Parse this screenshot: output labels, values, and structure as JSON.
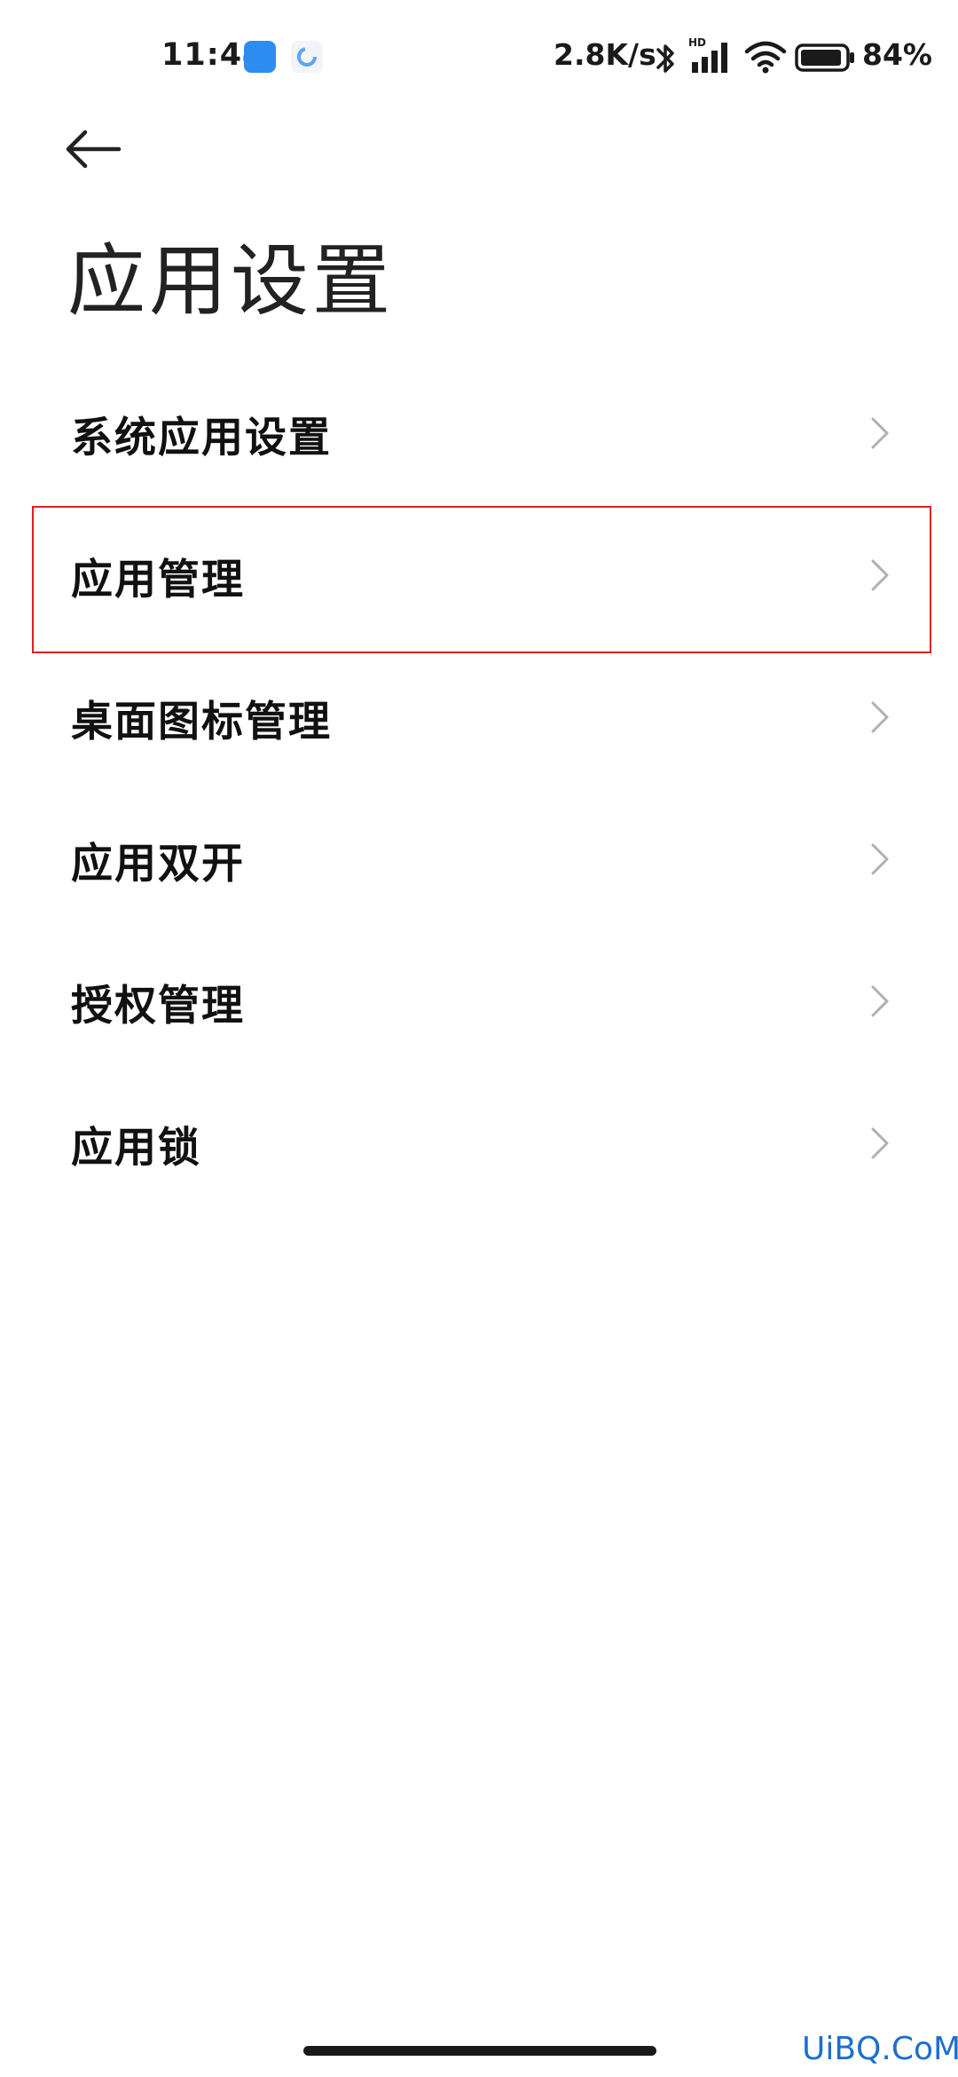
{
  "status_bar": {
    "time": "11:44",
    "net_speed": "2.8K/s",
    "battery": "84%",
    "icons": [
      "app-notification-icon",
      "app-notification-icon-2",
      "bluetooth-icon",
      "hd-signal-icon",
      "wifi-icon",
      "battery-icon"
    ]
  },
  "header": {
    "back_icon": "arrow-left-icon",
    "title": "应用设置"
  },
  "list": {
    "items": [
      {
        "label": "系统应用设置"
      },
      {
        "label": "应用管理"
      },
      {
        "label": "桌面图标管理"
      },
      {
        "label": "应用双开"
      },
      {
        "label": "授权管理"
      },
      {
        "label": "应用锁"
      }
    ],
    "chevron_icon": "chevron-right-icon",
    "highlighted_index": 1
  },
  "colors": {
    "highlight_border": "#e02020",
    "chevron": "#b0b0b0",
    "watermark": "#1c6fd0"
  },
  "watermark": {
    "text": "UiBQ.CoM"
  }
}
